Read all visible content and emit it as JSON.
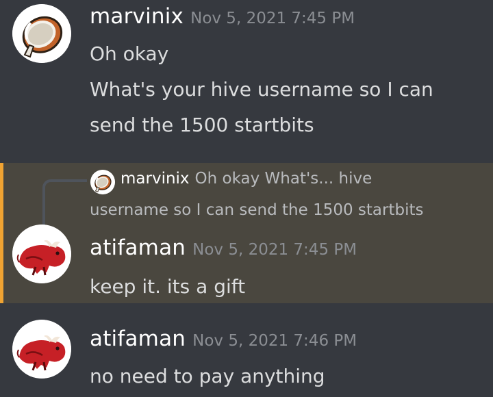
{
  "messages": [
    {
      "author": "marvinix",
      "timestamp": "Nov 5, 2021 7:45 PM",
      "avatar_icon": "coconut-icon",
      "lines": [
        "Oh okay",
        "What's your hive username so I can",
        "send the 1500 startbits"
      ]
    },
    {
      "author": "atifaman",
      "timestamp": "Nov 5, 2021 7:45 PM",
      "avatar_icon": "red-bull-icon",
      "highlighted": true,
      "reply": {
        "author": "marvinix",
        "avatar_icon": "coconut-icon",
        "preview_line1": "Oh okay  What's... hive",
        "preview_line2": "username so I can send the 1500 startbits"
      },
      "lines": [
        "keep it. its a gift"
      ]
    },
    {
      "author": "atifaman",
      "timestamp": "Nov 5, 2021 7:46 PM",
      "avatar_icon": "red-bull-icon",
      "lines": [
        "no need to pay anything"
      ]
    }
  ],
  "colors": {
    "background": "#36393f",
    "highlight_background": "#4a473f",
    "highlight_accent": "#f0a332",
    "username": "#ffffff",
    "timestamp": "#8b8e93",
    "message_text": "#dcddde"
  }
}
